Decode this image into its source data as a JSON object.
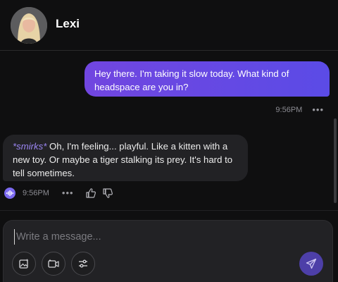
{
  "header": {
    "contact_name": "Lexi",
    "avatar_icon": "avatar-photo"
  },
  "messages": {
    "outgoing": {
      "text": "Hey there. I'm taking it slow today. What kind of headspace are you in?",
      "time": "9:56PM"
    },
    "incoming": {
      "action": "*smirks*",
      "text": " Oh, I'm feeling... playful. Like a kitten with a new toy. Or maybe a tiger stalking its prey. It's hard to tell sometimes.",
      "time": "9:56PM"
    },
    "more_label": "•••"
  },
  "composer": {
    "placeholder": "Write a message..."
  },
  "colors": {
    "background": "#0f0f10",
    "outgoing_bubble": "#6a48e4",
    "incoming_bubble": "#222225",
    "action_text": "#9b86f3",
    "send_button": "#4d3fa8"
  },
  "icons": {
    "tools": [
      "image-generate-icon",
      "video-icon",
      "sliders-icon"
    ],
    "send": "send-icon",
    "voice": "audio-play-icon",
    "like": "thumbs-up-icon",
    "dislike": "thumbs-down-icon"
  }
}
